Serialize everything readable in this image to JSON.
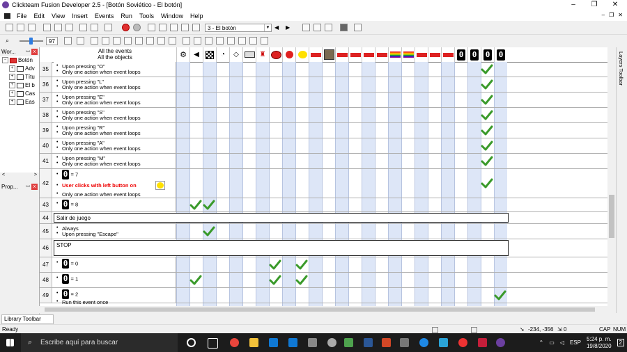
{
  "window": {
    "title": "Clickteam Fusion Developer 2.5 - [Botón Soviético - El botón]",
    "controls": [
      "‒",
      "❐",
      "✕"
    ]
  },
  "menu": [
    "File",
    "Edit",
    "View",
    "Insert",
    "Events",
    "Run",
    "Tools",
    "Window",
    "Help"
  ],
  "menu_right": [
    "‒",
    "❐",
    "✕"
  ],
  "toolbar": {
    "frame_combo": "3 - El botón",
    "zoom_value": "97"
  },
  "workspace": {
    "header": "Wor...",
    "pin": "ꟷ",
    "close": "x",
    "items": [
      {
        "label": "Botón",
        "level": 0,
        "icon": "flag-icon"
      },
      {
        "label": "Adv",
        "level": 1,
        "icon": "frame-icon"
      },
      {
        "label": "Títu",
        "level": 1,
        "icon": "frame-icon"
      },
      {
        "label": "El b",
        "level": 1,
        "icon": "frame-icon"
      },
      {
        "label": "Cas",
        "level": 1,
        "icon": "frame-icon"
      },
      {
        "label": "Eas",
        "level": 1,
        "icon": "frame-icon"
      }
    ],
    "scroll_left": "<",
    "scroll_right": ">"
  },
  "properties": {
    "header": "Prop..."
  },
  "events_header": {
    "line1": "All the events",
    "line2": "All the objects"
  },
  "objects_header_digits": [
    "0",
    "0",
    "0",
    "0"
  ],
  "rows": [
    {
      "n": "35",
      "lines": [
        "Upon pressing \"O\"",
        "Only one action when event loops"
      ]
    },
    {
      "n": "36",
      "lines": [
        "Upon pressing \"L\"",
        "Only one action when event loops"
      ]
    },
    {
      "n": "37",
      "lines": [
        "Upon pressing \"E\"",
        "Only one action when event loops"
      ]
    },
    {
      "n": "38",
      "lines": [
        "Upon pressing \"S\"",
        "Only one action when event loops"
      ]
    },
    {
      "n": "39",
      "lines": [
        "Upon pressing \"R\"",
        "Only one action when event loops"
      ]
    },
    {
      "n": "40",
      "lines": [
        "Upon pressing \"A\"",
        "Only one action when event loops"
      ]
    },
    {
      "n": "41",
      "lines": [
        "Upon pressing \"M\"",
        "Only one action when event loops"
      ]
    },
    {
      "n": "42",
      "counter_text": "= 7",
      "red_text": "User clicks with left button on",
      "line3": "Only one action when event loops"
    },
    {
      "n": "43",
      "counter_text": "= 8"
    },
    {
      "n": "44",
      "group": "Salir de juego"
    },
    {
      "n": "45",
      "lines": [
        "Always",
        "Upon pressing \"Escape\""
      ]
    },
    {
      "n": "46",
      "group": "STOP"
    },
    {
      "n": "47",
      "counter_text": "= 0"
    },
    {
      "n": "48",
      "counter_text": "= 1"
    },
    {
      "n": "49",
      "counter_text": "= 2",
      "line2": "Run this event once"
    }
  ],
  "counter_glyph": "0",
  "checkmark": "✔",
  "layers_toolbar": "Layers Toolbar",
  "library_tab": "Library Toolbar",
  "status": {
    "left": "Ready",
    "coords": "-234, -356",
    "count": "0",
    "cap": "CAP",
    "num": "NUM"
  },
  "taskbar": {
    "search_placeholder": "Escribe aquí para buscar",
    "lang": "ESP",
    "time": "5:24 p. m.",
    "date": "19/8/2020",
    "notif": "2"
  }
}
